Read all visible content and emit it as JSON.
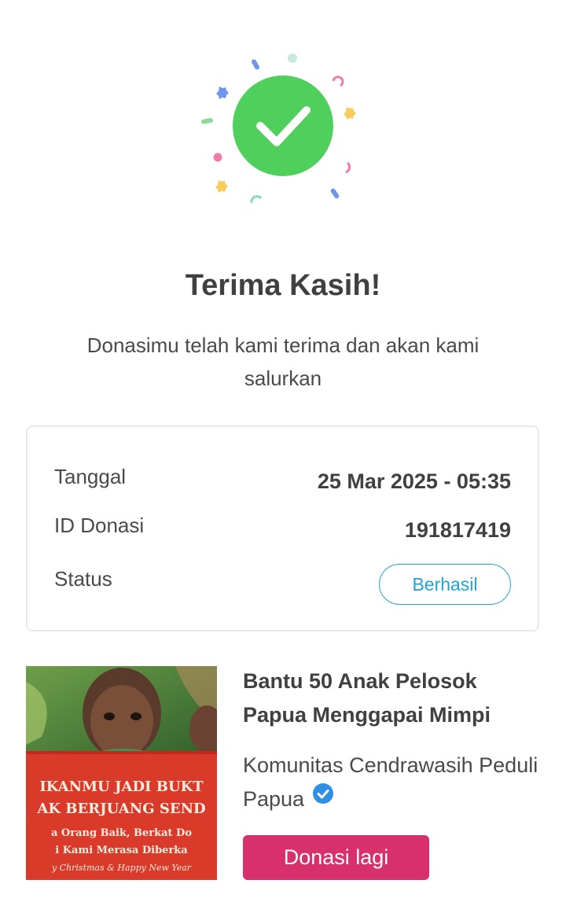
{
  "success": {
    "title": "Terima Kasih!",
    "message": "Donasimu telah kami terima dan akan kami salurkan",
    "icon": "check-circle-icon",
    "accent_color": "#4fcf5c"
  },
  "details": {
    "date_label": "Tanggal",
    "date_value": "25 Mar 2025 - 05:35",
    "id_label": "ID Donasi",
    "id_value": "191817419",
    "status_label": "Status",
    "status_value": "Berhasil",
    "status_color": "#1fa3d6"
  },
  "campaign": {
    "title": "Bantu 50 Anak Pelosok Papua Menggapai Mimpi",
    "organizer": "Komunitas Cendrawasih Peduli Papua",
    "verified_icon": "verified-badge-icon",
    "image_text": {
      "line1": "IKANMU JADI BUKT",
      "line2": "AK BERJUANG SEND",
      "line3": "a Orang Baik, Berkat Do",
      "line4": "i Kami Merasa Diberka",
      "line5": "y Christmas & Happy New Year"
    }
  },
  "actions": {
    "donate_again_label": "Donasi lagi",
    "button_color": "#d8306a"
  }
}
